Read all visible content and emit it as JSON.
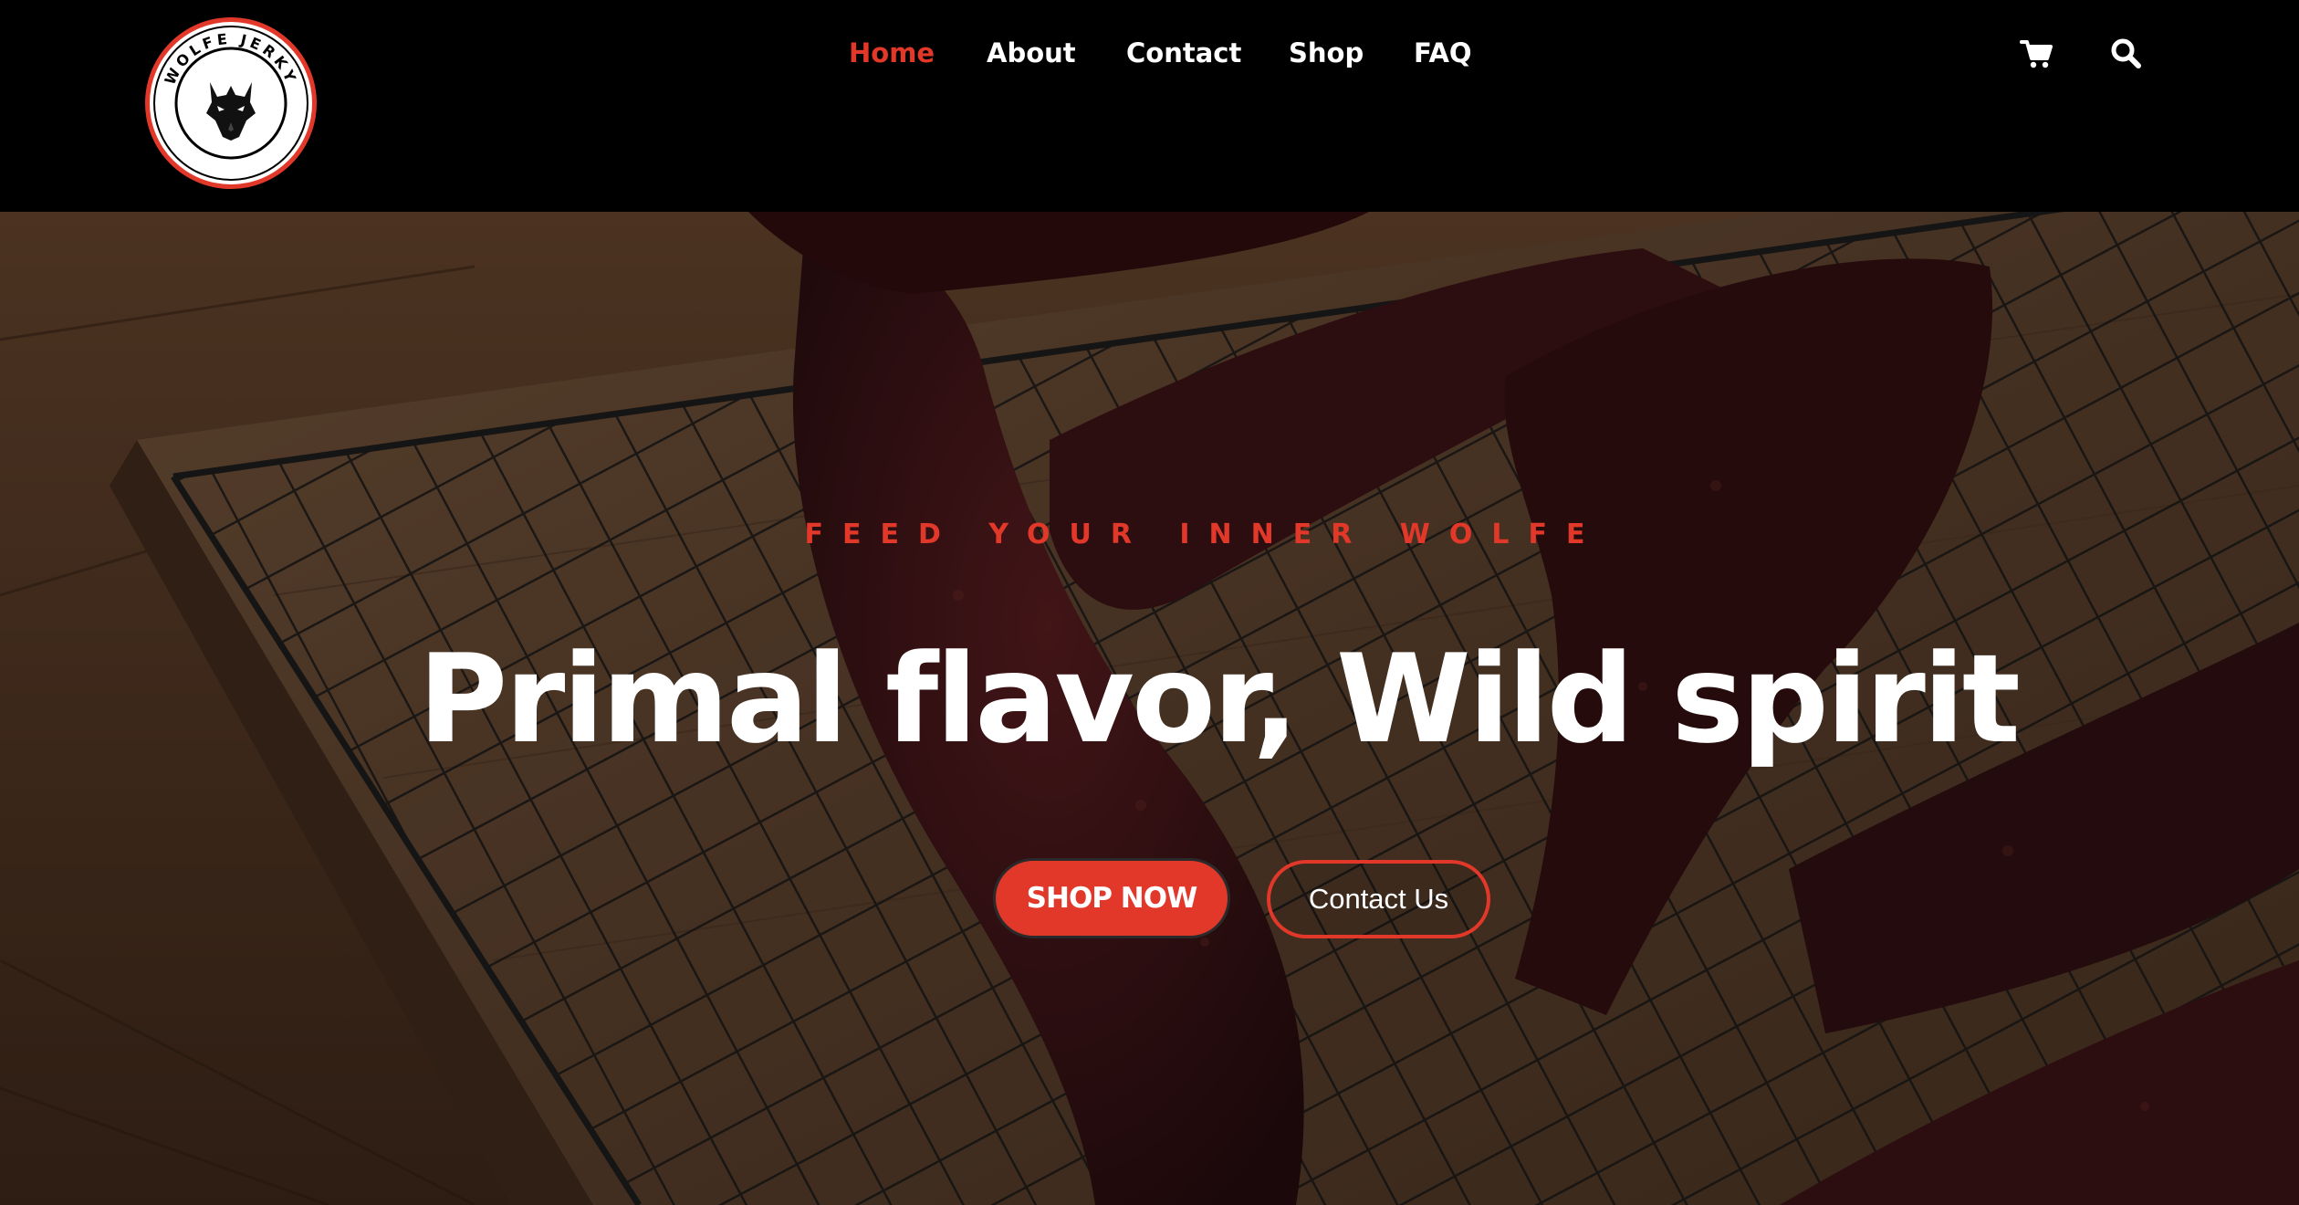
{
  "brand": {
    "logo_text": "WOLFE JERKY",
    "logo_icon": "wolf-head-icon"
  },
  "nav": {
    "items": [
      {
        "label": "Home",
        "active": true
      },
      {
        "label": "About",
        "active": false
      },
      {
        "label": "Contact",
        "active": false
      },
      {
        "label": "Shop",
        "active": false
      },
      {
        "label": "FAQ",
        "active": false
      }
    ],
    "icons": [
      "cart-icon",
      "search-icon"
    ]
  },
  "hero": {
    "eyebrow": "FEED YOUR INNER WOLFE",
    "headline": "Primal flavor, Wild spirit",
    "primary_button": "SHOP NOW",
    "secondary_button": "Contact Us",
    "background_image": "beef jerky strips on a wire cooling rack over a wooden cutting board"
  },
  "colors": {
    "accent": "#e2382a",
    "header_bg": "#000000",
    "text_light": "#ffffff"
  }
}
